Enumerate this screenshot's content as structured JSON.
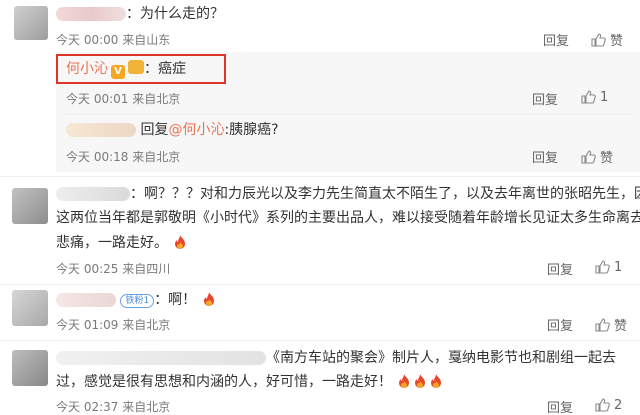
{
  "comments": [
    {
      "text": "：为什么走的？",
      "time": "今天 00:00  来自山东",
      "reply_label": "回复",
      "like_label": "赞"
    },
    {
      "author": "何小沁",
      "text": "：癌症",
      "time": "今天 00:01  来自北京",
      "reply_label": "回复",
      "likes": "1"
    },
    {
      "reply_prefix": "回复",
      "mention": "@何小沁",
      "text": ":胰腺癌?",
      "time": "今天 00:18  来自北京",
      "reply_label": "回复",
      "like_label": "赞"
    },
    {
      "line1": "：啊？？？对和力辰光以及李力先生简直太不陌生了，以及去年离世的张昭先生，因为",
      "line2": "这两位当年都是郭敬明《小时代》系列的主要出品人，难以接受随着年龄增长见证太多生命离去的",
      "line3": "悲痛，一路走好。",
      "time": "今天 00:25  来自四川",
      "reply_label": "回复",
      "likes": "1"
    },
    {
      "badge": "铁粉1",
      "text": "：啊！",
      "time": "今天 01:09  来自北京",
      "reply_label": "回复",
      "like_label": "赞"
    },
    {
      "line1": "《南方车站的聚会》制片人，戛纳电影节也和剧组一起去",
      "line2": "过，感觉是很有思想和内涵的人，好可惜，一路走好！",
      "time": "今天 02:37  来自北京",
      "reply_label": "回复",
      "likes": "2"
    }
  ],
  "colors": {
    "accent": "#eb7350",
    "highlight": "#e0352b"
  },
  "icons": {
    "like": "thumbs-up-icon",
    "fire": "fire-emoji-icon"
  }
}
